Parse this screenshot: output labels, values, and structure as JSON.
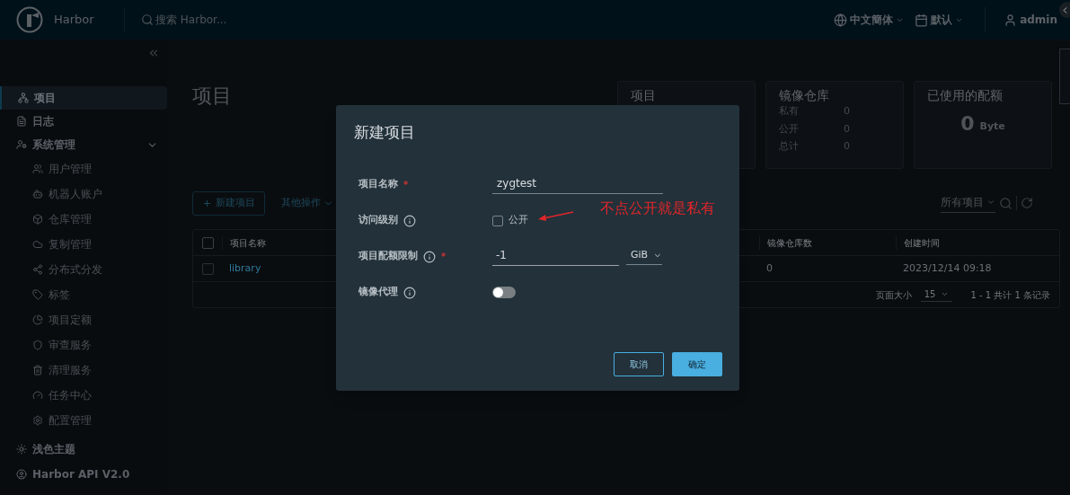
{
  "header": {
    "brand": "Harbor",
    "search_placeholder": "搜索 Harbor...",
    "language": "中文簡体",
    "theme": "默认",
    "user": "admin"
  },
  "sidebar": {
    "items": [
      {
        "label": "项目",
        "selected": true
      },
      {
        "label": "日志",
        "selected": false
      },
      {
        "label": "系统管理",
        "selected": false,
        "expanded": true,
        "children": [
          {
            "label": "用户管理",
            "selected": false
          },
          {
            "label": "机器人账户",
            "selected": false
          },
          {
            "label": "仓库管理",
            "selected": false
          },
          {
            "label": "复制管理",
            "selected": false
          },
          {
            "label": "分布式分发",
            "selected": false
          },
          {
            "label": "标签",
            "selected": false
          },
          {
            "label": "项目定额",
            "selected": false
          },
          {
            "label": "审查服务",
            "selected": false
          },
          {
            "label": "清理服务",
            "selected": false
          },
          {
            "label": "任务中心",
            "selected": false
          },
          {
            "label": "配置管理",
            "selected": false
          }
        ]
      }
    ],
    "footer": [
      "浅色主题",
      "Harbor API V2.0"
    ]
  },
  "page": {
    "title": "项目",
    "cards": [
      {
        "kind": "title",
        "title": "项目"
      },
      {
        "kind": "counts",
        "title": "镜像仓库",
        "rows": [
          {
            "label": "私有",
            "value": "0"
          },
          {
            "label": "公开",
            "value": "0"
          },
          {
            "label": "总计",
            "value": "0"
          }
        ]
      },
      {
        "kind": "quota",
        "title": "已使用的配额",
        "value": "0",
        "unit": "Byte"
      }
    ],
    "toolbar": {
      "new_button": "新建项目",
      "more": "其他操作",
      "filter": "所有项目"
    },
    "table": {
      "all_checked": false,
      "columns": [
        "项目名称",
        "镜像仓库数",
        "创建时间"
      ],
      "rows": [
        {
          "name": "library",
          "repos": "0",
          "created": "2023/12/14 09:18",
          "checked": false
        }
      ],
      "footer": {
        "page_size_label": "页面大小",
        "page_size": "15",
        "summary": "1 - 1 共计 1 条记录"
      }
    }
  },
  "dialog": {
    "title": "新建项目",
    "fields": [
      {
        "kind": "text",
        "label": "项目名称",
        "required_mark": "*",
        "info": false,
        "value": "zygtest"
      },
      {
        "kind": "checkbox",
        "label": "访问级别",
        "info": true,
        "option": "公开",
        "checked": false
      },
      {
        "kind": "quota",
        "label": "项目配额限制",
        "required_mark": "*",
        "info": true,
        "value": "-1",
        "unit": "GiB"
      },
      {
        "kind": "toggle",
        "label": "镜像代理",
        "info": true,
        "on": false
      }
    ],
    "buttons": [
      {
        "label": "取消",
        "kind": "secondary"
      },
      {
        "label": "确定",
        "kind": "primary"
      }
    ],
    "annotation": "不点公开就是私有"
  }
}
